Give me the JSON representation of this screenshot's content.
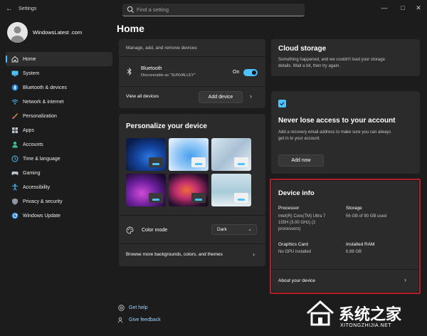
{
  "window": {
    "title": "Settings",
    "search_placeholder": "Find a setting"
  },
  "profile": {
    "name": "WindowsLatest .com"
  },
  "nav": {
    "items": [
      {
        "label": "Home",
        "icon": "home-icon",
        "active": true
      },
      {
        "label": "System",
        "icon": "monitor-icon"
      },
      {
        "label": "Bluetooth & devices",
        "icon": "bluetooth-icon"
      },
      {
        "label": "Network & internet",
        "icon": "wifi-icon"
      },
      {
        "label": "Personalization",
        "icon": "brush-icon"
      },
      {
        "label": "Apps",
        "icon": "apps-icon"
      },
      {
        "label": "Accounts",
        "icon": "person-icon"
      },
      {
        "label": "Time & language",
        "icon": "globe-clock-icon"
      },
      {
        "label": "Gaming",
        "icon": "gamepad-icon"
      },
      {
        "label": "Accessibility",
        "icon": "accessibility-icon"
      },
      {
        "label": "Privacy & security",
        "icon": "shield-icon"
      },
      {
        "label": "Windows Update",
        "icon": "update-icon"
      }
    ]
  },
  "main": {
    "title": "Home",
    "devices_card": {
      "header": "Manage, add, and remove devices",
      "bluetooth_title": "Bluetooth",
      "bluetooth_status": "Discoverable as \"SUNVALLEY\"",
      "toggle_label": "On",
      "view_all": "View all devices",
      "add_device": "Add device"
    },
    "personalize": {
      "title": "Personalize your device",
      "color_mode_label": "Color mode",
      "color_mode_value": "Dark",
      "browse": "Browse more backgrounds, colors, and themes"
    },
    "help": {
      "get_help": "Get help",
      "give_feedback": "Give feedback"
    }
  },
  "right": {
    "cloud": {
      "title": "Cloud storage",
      "desc_1": "Something happened, and we couldn't load your storage",
      "desc_2": "details. Wait a bit, then try again."
    },
    "access": {
      "title": "Never lose access to your account",
      "desc_1": "Add a recovery email address to make sure you can always",
      "desc_2": "get in to your account.",
      "button": "Add now"
    },
    "device_info": {
      "title": "Device info",
      "processor_label": "Processor",
      "processor_line1": "Intel(R) Core(TM) Ultra 7",
      "processor_line2": "155H (3.00 GHz) (2",
      "processor_line3": "processors)",
      "storage_label": "Storage",
      "storage_value": "56 GB of 90 GB used",
      "graphics_label": "Graphics Card",
      "graphics_value": "No GPU installed",
      "ram_label": "Installed RAM",
      "ram_value": "6.88 GB",
      "about": "About your device"
    }
  },
  "watermark": {
    "brand": "系统之家",
    "url": "XITONGZHIJIA.NET"
  },
  "colors": {
    "accent": "#4cc2ff",
    "highlight_border": "#b21f2d"
  }
}
